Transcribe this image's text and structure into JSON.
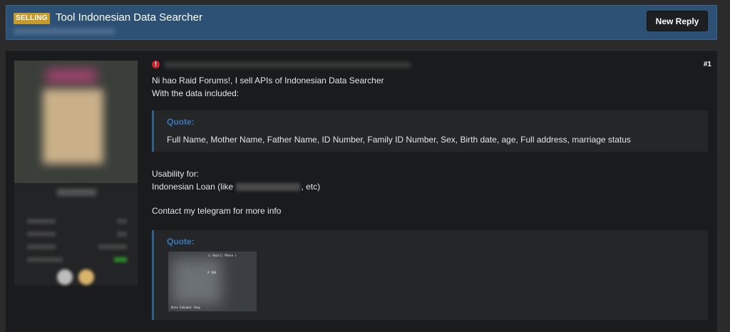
{
  "thread": {
    "badge": "SELLING",
    "title": "Tool Indonesian Data Searcher",
    "reply_button": "New Reply"
  },
  "post": {
    "number": "#1",
    "lines": [
      "Ni hao Raid Forums!, I sell APIs of Indonesian Data Searcher",
      "With the data included:"
    ],
    "quote1": {
      "label": "Quote:",
      "text": "Full Name, Mother Name, Father Name, ID Number, Family ID Number, Sex, Birth date, age, Full address, marriage status"
    },
    "usability_label": "Usability for:",
    "usability_prefix": "Indonesian Loan (like",
    "usability_suffix": ", etc)",
    "contact": "Contact my telegram for more info",
    "quote2": {
      "label": "Quote:",
      "thumb_lines": [
        ")| Email| Phone )",
        "# 300",
        "Data Sahabat Shop"
      ]
    }
  },
  "colors": {
    "header_bg": "#2c5175",
    "badge": "#c79a2c",
    "quote_border": "#2e5f8e",
    "quote_label": "#3a78b8",
    "warning": "#c8262c"
  },
  "icons": {
    "warning": "warning-icon"
  }
}
